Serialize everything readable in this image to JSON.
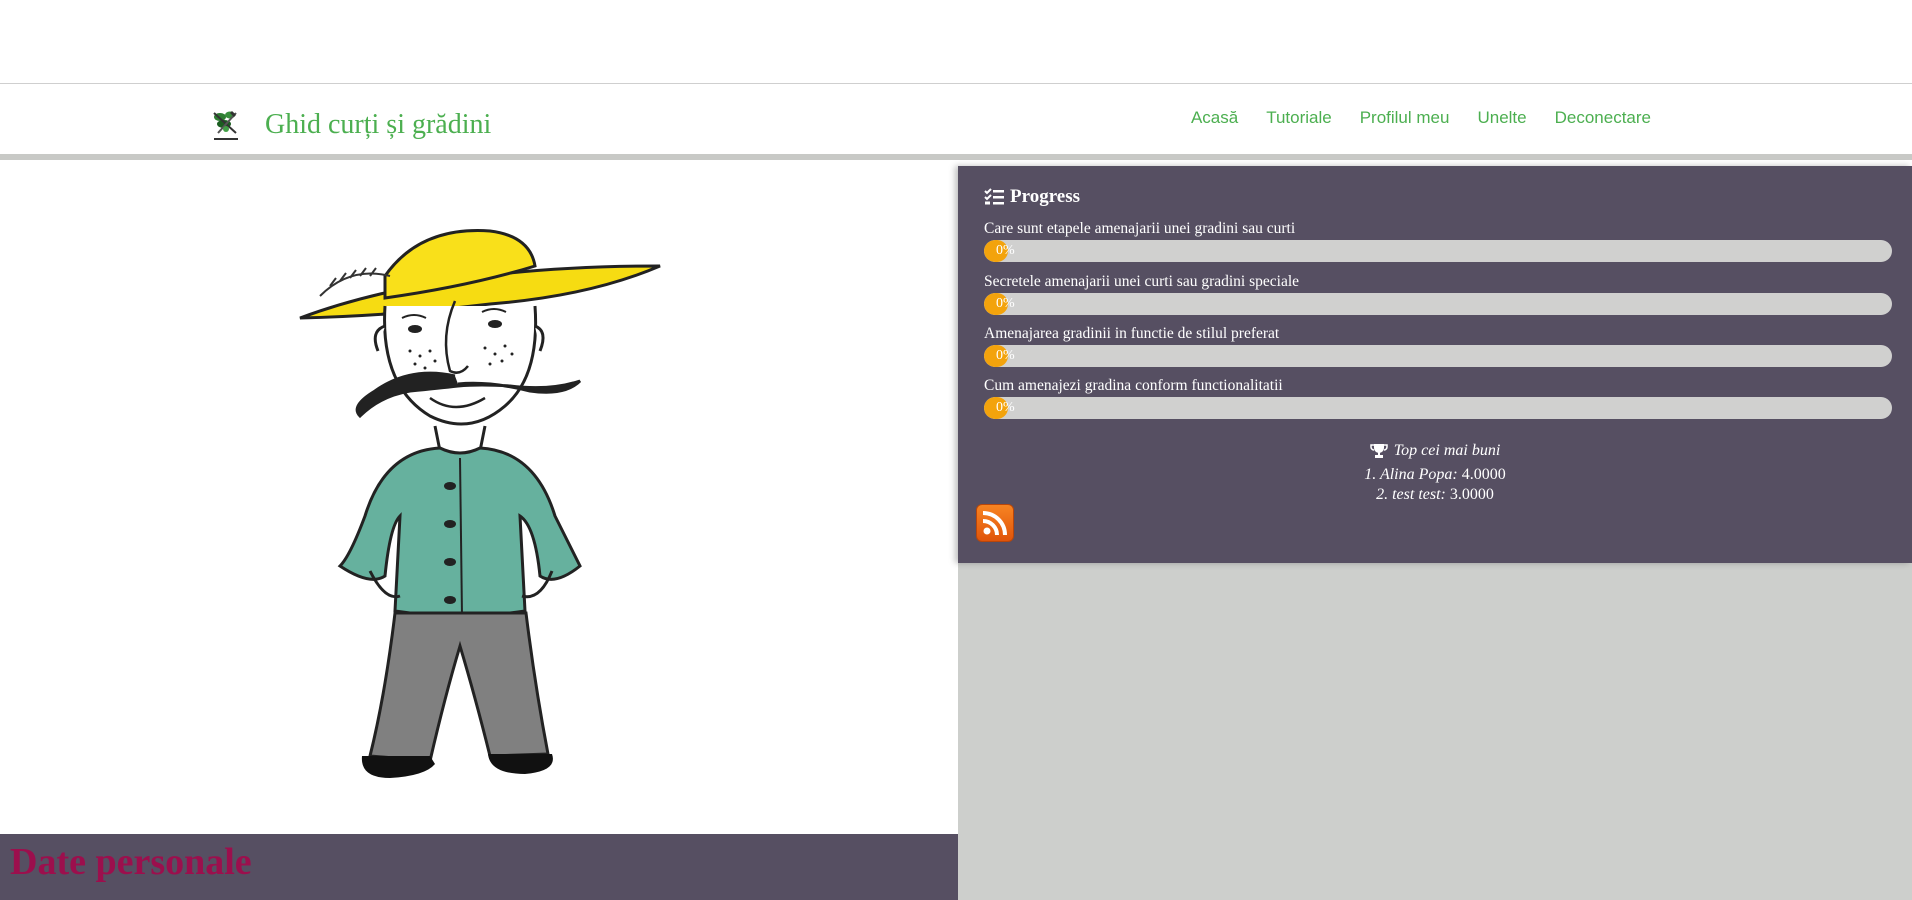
{
  "header": {
    "brand_title": "Ghid curți și grădini",
    "logo_icon": "garden-tools-logo",
    "nav": [
      {
        "label": "Acasă"
      },
      {
        "label": "Tutoriale"
      },
      {
        "label": "Profilul meu"
      },
      {
        "label": "Unelte"
      },
      {
        "label": "Deconectare"
      }
    ]
  },
  "progress": {
    "title": "Progress",
    "icon": "tasks-list-icon",
    "items": [
      {
        "label": "Care sunt etapele amenajarii unei gradini sau curti",
        "percent_text": "0%",
        "percent": 0
      },
      {
        "label": "Secretele amenajarii unei curti sau gradini speciale",
        "percent_text": "0%",
        "percent": 0
      },
      {
        "label": "Amenajarea gradinii in functie de stilul preferat",
        "percent_text": "0%",
        "percent": 0
      },
      {
        "label": "Cum amenajezi gradina conform functionalitatii",
        "percent_text": "0%",
        "percent": 0
      }
    ]
  },
  "leaderboard": {
    "title": "Top cei mai buni",
    "icon": "trophy-icon",
    "rows": [
      {
        "rank_name": "1. Alina Popa:",
        "score": "4.0000"
      },
      {
        "rank_name": "2. test test:",
        "score": "3.0000"
      }
    ]
  },
  "rss_icon": "rss-feed-icon",
  "personal": {
    "title": "Date personale"
  },
  "colors": {
    "accent_green": "#4caf50",
    "panel": "#564f62",
    "progress_fill": "#f3a30c",
    "personal_title": "#9c0f4d"
  }
}
